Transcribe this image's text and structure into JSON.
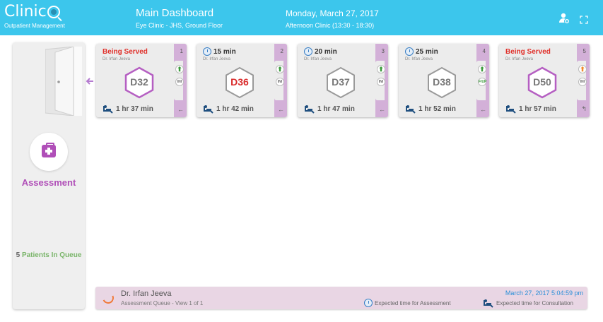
{
  "header": {
    "logo_text": "Clinic",
    "logo_subtitle": "Outpatient Management",
    "dashboard_title": "Main Dashboard",
    "dashboard_location": "Eye Clinic - JHS, Ground Floor",
    "date": "Monday, March 27, 2017",
    "session": "Afternoon Clinic (13:30 - 18:30)",
    "icons": [
      "add-user-icon",
      "fullscreen-icon"
    ]
  },
  "sidebar": {
    "station_name": "Assessment",
    "queue_count": "5",
    "queue_label": "Patients In Queue",
    "icons": [
      "door-icon",
      "medical-kit-icon",
      "back-arrow-icon"
    ]
  },
  "cards": [
    {
      "position": "1",
      "status": "Being Served",
      "doctor": "Dr. Irfan Jeeva",
      "token": "D32",
      "elapsed": "1 hr 37 min",
      "icon_top": "up-arrow-green",
      "icon_bottom": "INI",
      "action": "←"
    },
    {
      "position": "2",
      "status": "15 min",
      "doctor": "Dr. Irfan Jeeva",
      "token": "D36",
      "elapsed": "1 hr 42 min",
      "icon_top": "up-arrow-green",
      "icon_bottom": "INI",
      "action": "←"
    },
    {
      "position": "3",
      "status": "20 min",
      "doctor": "Dr. Irfan Jeeva",
      "token": "D37",
      "elapsed": "1 hr 47 min",
      "icon_top": "up-arrow-green",
      "icon_bottom": "INI",
      "action": "←"
    },
    {
      "position": "4",
      "status": "25 min",
      "doctor": "Dr. Irfan Jeeva",
      "token": "D38",
      "elapsed": "1 hr 52 min",
      "icon_top": "up-arrow-green",
      "icon_bottom": "F/UP",
      "action": "←"
    },
    {
      "position": "5",
      "status": "Being Served",
      "doctor": "Dr. Irfan Jeeva",
      "token": "D50",
      "elapsed": "1 hr 57 min",
      "icon_top": "up-arrow-orange",
      "icon_bottom": "INI",
      "action": "↰"
    }
  ],
  "footer": {
    "doctor": "Dr. Irfan Jeeva",
    "queue_view": "Assessment Queue - View 1 of 1",
    "timestamp": "March 27, 2017 5:04:59 pm",
    "legend_assessment": "Expected time for Assessment",
    "legend_consultation": "Expected time for Consultation"
  },
  "colors": {
    "header": "#3cc6ec",
    "accent_purple": "#b04fb8",
    "stripe": "#d3b0d8",
    "served_red": "#e0302a",
    "token_highlight": "#d92b2b",
    "hex_purple": "#b55fc2",
    "hex_grey": "#9a9a9a",
    "footer_bg": "#e9d6e4"
  }
}
